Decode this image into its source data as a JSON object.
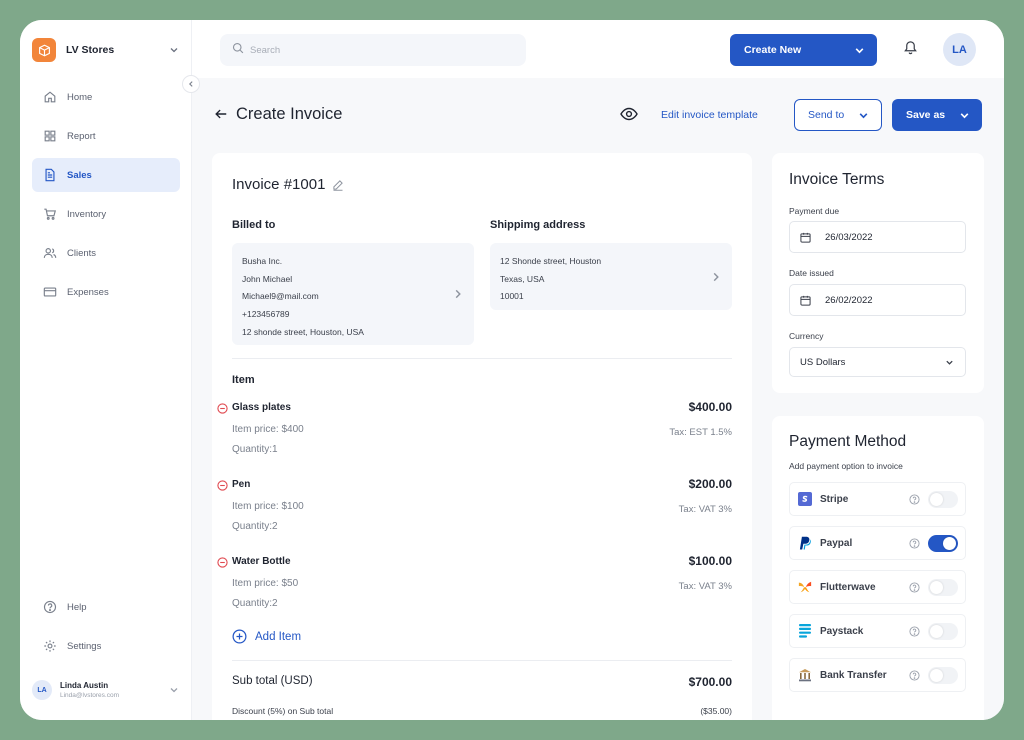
{
  "sidebar": {
    "brand": "LV Stores",
    "items": [
      {
        "label": "Home",
        "icon": "home-icon"
      },
      {
        "label": "Report",
        "icon": "grid-icon"
      },
      {
        "label": "Sales",
        "icon": "document-icon",
        "active": true
      },
      {
        "label": "Inventory",
        "icon": "cart-icon"
      },
      {
        "label": "Clients",
        "icon": "users-icon"
      },
      {
        "label": "Expenses",
        "icon": "card-icon"
      }
    ],
    "bottom_items": [
      {
        "label": "Help",
        "icon": "help-icon"
      },
      {
        "label": "Settings",
        "icon": "gear-icon"
      }
    ],
    "user": {
      "initials": "LA",
      "name": "Linda Austin",
      "email": "Linda@lvstores.com"
    }
  },
  "topbar": {
    "search_placeholder": "Search",
    "create_new": "Create New",
    "avatar": "LA"
  },
  "page": {
    "title": "Create Invoice",
    "edit_template": "Edit invoice template",
    "send_to": "Send to",
    "save_as": "Save as"
  },
  "invoice": {
    "title": "Invoice #1001",
    "billed_to_label": "Billed to",
    "billed_to": [
      "Busha Inc.",
      "John Michael",
      "Michael9@mail.com",
      "+123456789",
      "12 shonde street, Houston, USA"
    ],
    "shipping_label": "Shippimg address",
    "shipping": [
      "12 Shonde street, Houston",
      "Texas, USA",
      "10001"
    ],
    "item_label": "Item",
    "items": [
      {
        "name": "Glass plates",
        "price": "Item price: $400",
        "qty": "Quantity:1",
        "amount": "$400.00",
        "tax": "Tax: EST 1.5%"
      },
      {
        "name": "Pen",
        "price": "Item price: $100",
        "qty": "Quantity:2",
        "amount": "$200.00",
        "tax": "Tax: VAT 3%"
      },
      {
        "name": "Water Bottle",
        "price": "Item price: $50",
        "qty": "Quantity:2",
        "amount": "$100.00",
        "tax": "Tax: VAT 3%"
      }
    ],
    "add_item": "Add Item",
    "subtotal_label": "Sub total (USD)",
    "subtotal": "$700.00",
    "discount_label": "Discount (5%) on Sub total",
    "discount": "($35.00)"
  },
  "terms": {
    "title": "Invoice Terms",
    "payment_due_label": "Payment due",
    "payment_due": "26/03/2022",
    "date_issued_label": "Date issued",
    "date_issued": "26/02/2022",
    "currency_label": "Currency",
    "currency": "US Dollars"
  },
  "payment": {
    "title": "Payment Method",
    "subtitle": "Add payment option to invoice",
    "methods": [
      {
        "name": "Stripe",
        "icon": "stripe-icon",
        "enabled": false
      },
      {
        "name": "Paypal",
        "icon": "paypal-icon",
        "enabled": true
      },
      {
        "name": "Flutterwave",
        "icon": "flutterwave-icon",
        "enabled": false
      },
      {
        "name": "Paystack",
        "icon": "paystack-icon",
        "enabled": false
      },
      {
        "name": "Bank Transfer",
        "icon": "bank-icon",
        "enabled": false
      }
    ]
  },
  "colors": {
    "accent": "#2457c5",
    "brand": "#f2853a",
    "background": "#7fa88a",
    "danger": "#e0484f"
  }
}
